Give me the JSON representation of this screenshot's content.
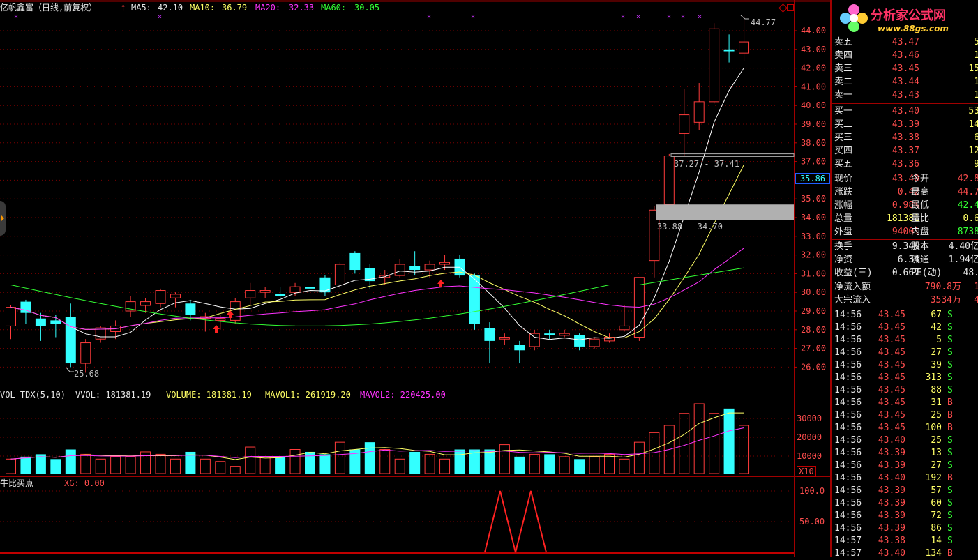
{
  "header": {
    "title": "亿帆鑫富（日线,前复权）",
    "ma5_label": "MA5:",
    "ma5": "42.10",
    "ma10_label": "MA10:",
    "ma10": "36.79",
    "ma20_label": "MA20:",
    "ma20": "32.33",
    "ma60_label": "MA60:",
    "ma60": "30.05"
  },
  "annotations": {
    "high": "44.77",
    "low": "25.68",
    "gap_upper": "37.27 - 37.41",
    "gap_lower": "33.88 - 34.70",
    "price_tag": "35.86"
  },
  "price_axis": [
    "44.00",
    "43.00",
    "42.00",
    "41.00",
    "40.00",
    "39.00",
    "38.00",
    "37.00",
    "36.00",
    "35.00",
    "34.00",
    "33.00",
    "32.00",
    "31.00",
    "30.00",
    "29.00",
    "28.00",
    "27.00",
    "26.00"
  ],
  "volume_panel": {
    "name": "VOL-TDX(5,10)",
    "vvol": "VVOL: 181381.19",
    "volume": "VOLUME: 181381.19",
    "mavol1": "MAVOL1: 261919.20",
    "mavol2": "MAVOL2: 220425.00",
    "axis": [
      "30000",
      "20000",
      "10000"
    ],
    "unit": "X10"
  },
  "indicator_panel": {
    "name": "牛比买点",
    "xg": "XG: 0.00",
    "axis": [
      "100.0",
      "50.00"
    ]
  },
  "logo": {
    "name": "分析家公式网",
    "url": "www.88gs.com"
  },
  "quotes": {
    "sell": [
      {
        "label": "卖五",
        "price": "43.47",
        "vol": "5"
      },
      {
        "label": "卖四",
        "price": "43.46",
        "vol": "1"
      },
      {
        "label": "卖三",
        "price": "43.45",
        "vol": "15"
      },
      {
        "label": "卖二",
        "price": "43.44",
        "vol": "1"
      },
      {
        "label": "卖一",
        "price": "43.43",
        "vol": "1"
      }
    ],
    "buy": [
      {
        "label": "买一",
        "price": "43.40",
        "vol": "53"
      },
      {
        "label": "买二",
        "price": "43.39",
        "vol": "14"
      },
      {
        "label": "买三",
        "price": "43.38",
        "vol": "6"
      },
      {
        "label": "买四",
        "price": "43.37",
        "vol": "12"
      },
      {
        "label": "买五",
        "price": "43.36",
        "vol": "9"
      }
    ]
  },
  "stats": [
    {
      "l1": "现价",
      "v1": "43.40",
      "l2": "今开",
      "v2": "42.8"
    },
    {
      "l1": "涨跌",
      "v1": "0.42",
      "l2": "最高",
      "v2": "44.7"
    },
    {
      "l1": "涨幅",
      "v1": "0.98%",
      "l2": "最低",
      "v2": "42.4"
    },
    {
      "l1": "总量",
      "v1": "181381",
      "l2": "量比",
      "v2": "0.6"
    },
    {
      "l1": "外盘",
      "v1": "94001",
      "l2": "内盘",
      "v2": "8738"
    }
  ],
  "stats2": [
    {
      "l1": "换手",
      "v1": "9.34%",
      "l2": "股本",
      "v2": "4.40亿"
    },
    {
      "l1": "净资",
      "v1": "6.34",
      "l2": "流通",
      "v2": "1.94亿"
    },
    {
      "l1": "收益(三)",
      "v1": "0.667",
      "l2": "PE(动)",
      "v2": "48."
    }
  ],
  "flows": [
    {
      "label": "净流入额",
      "value": "790.8万",
      "extra": "1"
    },
    {
      "label": "大宗流入",
      "value": "3534万",
      "extra": "4"
    }
  ],
  "ticks": [
    {
      "t": "14:56",
      "p": "43.45",
      "v": "67",
      "s": "S"
    },
    {
      "t": "14:56",
      "p": "43.45",
      "v": "42",
      "s": "S"
    },
    {
      "t": "14:56",
      "p": "43.45",
      "v": "5",
      "s": "S"
    },
    {
      "t": "14:56",
      "p": "43.45",
      "v": "27",
      "s": "S"
    },
    {
      "t": "14:56",
      "p": "43.45",
      "v": "39",
      "s": "S"
    },
    {
      "t": "14:56",
      "p": "43.45",
      "v": "313",
      "s": "S"
    },
    {
      "t": "14:56",
      "p": "43.45",
      "v": "88",
      "s": "S"
    },
    {
      "t": "14:56",
      "p": "43.45",
      "v": "31",
      "s": "B"
    },
    {
      "t": "14:56",
      "p": "43.45",
      "v": "25",
      "s": "B"
    },
    {
      "t": "14:56",
      "p": "43.45",
      "v": "100",
      "s": "B"
    },
    {
      "t": "14:56",
      "p": "43.40",
      "v": "25",
      "s": "S"
    },
    {
      "t": "14:56",
      "p": "43.39",
      "v": "13",
      "s": "S"
    },
    {
      "t": "14:56",
      "p": "43.39",
      "v": "27",
      "s": "S"
    },
    {
      "t": "14:56",
      "p": "43.40",
      "v": "192",
      "s": "B"
    },
    {
      "t": "14:56",
      "p": "43.39",
      "v": "57",
      "s": "S"
    },
    {
      "t": "14:56",
      "p": "43.39",
      "v": "60",
      "s": "S"
    },
    {
      "t": "14:56",
      "p": "43.39",
      "v": "72",
      "s": "S"
    },
    {
      "t": "14:56",
      "p": "43.39",
      "v": "86",
      "s": "S"
    },
    {
      "t": "14:57",
      "p": "43.38",
      "v": "14",
      "s": "S"
    },
    {
      "t": "14:57",
      "p": "43.40",
      "v": "134",
      "s": "B"
    }
  ],
  "colors": {
    "up": "#ff3b3b",
    "down": "#33ffff",
    "ma5": "#ffffff",
    "ma10": "#ffff66",
    "ma20": "#ff33ff",
    "ma60": "#33ff33"
  }
}
